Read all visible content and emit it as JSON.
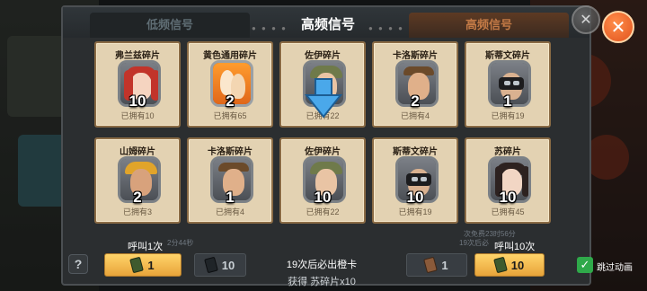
{
  "header": {
    "title": "高频信号",
    "tab_low": "低频信号",
    "tab_high": "高频信号"
  },
  "cards": [
    {
      "name": "弗兰兹碎片",
      "count": "10",
      "owned": "已拥有10",
      "portrait": "redhair-woman"
    },
    {
      "name": "黄色通用碎片",
      "count": "2",
      "owned": "已拥有65",
      "portrait": "generic-silhouette"
    },
    {
      "name": "佐伊碎片",
      "count": "",
      "owned": "已拥有22",
      "portrait": "zoe"
    },
    {
      "name": "卡洛斯碎片",
      "count": "2",
      "owned": "已拥有4",
      "portrait": "carlos"
    },
    {
      "name": "斯蒂文碎片",
      "count": "1",
      "owned": "已拥有19",
      "portrait": "masked-soldier"
    },
    {
      "name": "山姆碎片",
      "count": "2",
      "owned": "已拥有3",
      "portrait": "sam"
    },
    {
      "name": "卡洛斯碎片",
      "count": "1",
      "owned": "已拥有4",
      "portrait": "carlos"
    },
    {
      "name": "佐伊碎片",
      "count": "10",
      "owned": "已拥有22",
      "portrait": "zoe"
    },
    {
      "name": "斯蒂文碎片",
      "count": "10",
      "owned": "已拥有19",
      "portrait": "masked-soldier"
    },
    {
      "name": "苏碎片",
      "count": "10",
      "owned": "已拥有45",
      "portrait": "su"
    }
  ],
  "bottom": {
    "call_once_label": "呼叫1次",
    "call_ten_label": "呼叫10次",
    "call_once_cost": "1",
    "call_once_alt_cost": "10",
    "call_ten_alt_cost": "1",
    "call_ten_cost": "10",
    "guarantee_text": "19次后必出橙卡",
    "reward_text": "获得 苏碎片x10",
    "skip_animation_label": "跳过动画",
    "bg_timer_left": "2分44秒",
    "bg_timer_right": "次免费23时56分",
    "bg_guarantee_right": "19次后必",
    "bg_owned_left": "拥有2分14秒"
  },
  "icons": {
    "close": "close-icon",
    "help": "help-icon",
    "checkbox": "check-icon",
    "ticket": "ticket-icon",
    "arrow": "arrow-down-icon"
  },
  "colors": {
    "accent_orange": "#e1531e",
    "card_bg": "#e3d2b2",
    "button_yellow": "#ffd46a",
    "check_green": "#2fa94a"
  }
}
